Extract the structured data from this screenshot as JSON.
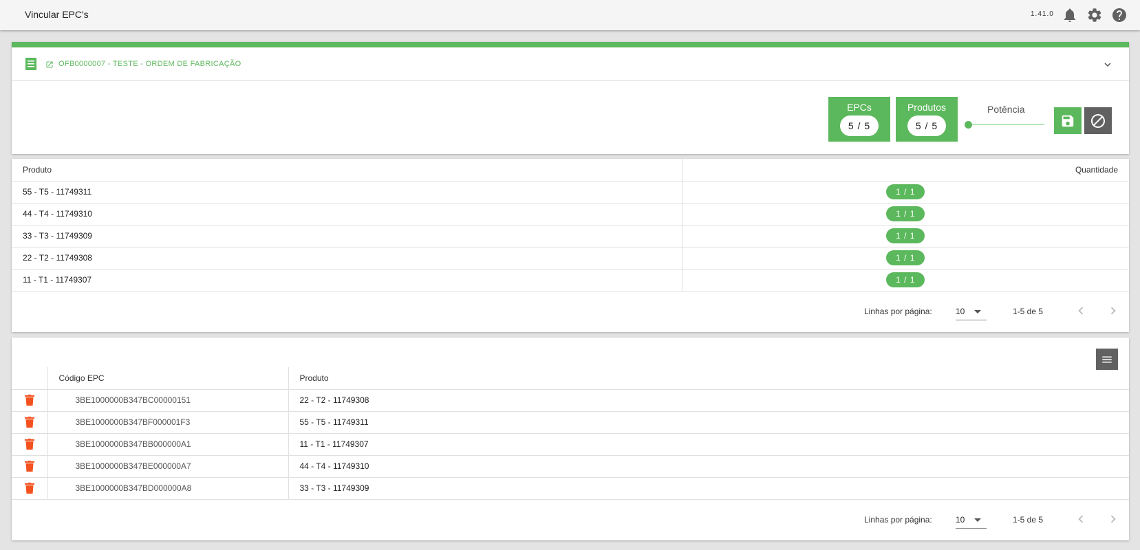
{
  "app": {
    "title": "Vincular EPC's",
    "version": "1.41.0"
  },
  "icons": {
    "notifications": "bell-icon",
    "settings": "gear-icon",
    "help": "help-icon"
  },
  "colors": {
    "accent": "#5cb85c",
    "danger": "#f4511e",
    "dark_button": "#616161"
  },
  "order": {
    "label": "OFB0000007 - TESTE - ORDEM DE FABRICAÇÃO"
  },
  "counters": {
    "epcs": {
      "label": "EPCs",
      "value": "5 / 5"
    },
    "produtos": {
      "label": "Produtos",
      "value": "5 / 5"
    }
  },
  "potencia": {
    "label": "Potência",
    "level_fraction": 0
  },
  "products_table": {
    "headers": {
      "produto": "Produto",
      "quantidade": "Quantidade"
    },
    "rows": [
      {
        "produto": "55 - T5 - 11749311",
        "quantidade": "1 / 1"
      },
      {
        "produto": "44 - T4 - 11749310",
        "quantidade": "1 / 1"
      },
      {
        "produto": "33 - T3 - 11749309",
        "quantidade": "1 / 1"
      },
      {
        "produto": "22 - T2 - 11749308",
        "quantidade": "1 / 1"
      },
      {
        "produto": "11 - T1 - 11749307",
        "quantidade": "1 / 1"
      }
    ],
    "pagination": {
      "rows_label": "Linhas por página:",
      "rows_value": "10",
      "range": "1-5 de 5"
    }
  },
  "epc_table": {
    "headers": {
      "codigo": "Código EPC",
      "produto": "Produto"
    },
    "rows": [
      {
        "codigo": "3BE1000000B347BC00000151",
        "produto": "22 - T2 - 11749308"
      },
      {
        "codigo": "3BE1000000B347BF000001F3",
        "produto": "55 - T5 - 11749311"
      },
      {
        "codigo": "3BE1000000B347BB000000A1",
        "produto": "11 - T1 - 11749307"
      },
      {
        "codigo": "3BE1000000B347BE000000A7",
        "produto": "44 - T4 - 11749310"
      },
      {
        "codigo": "3BE1000000B347BD000000A8",
        "produto": "33 - T3 - 11749309"
      }
    ],
    "pagination": {
      "rows_label": "Linhas por página:",
      "rows_value": "10",
      "range": "1-5 de 5"
    }
  }
}
